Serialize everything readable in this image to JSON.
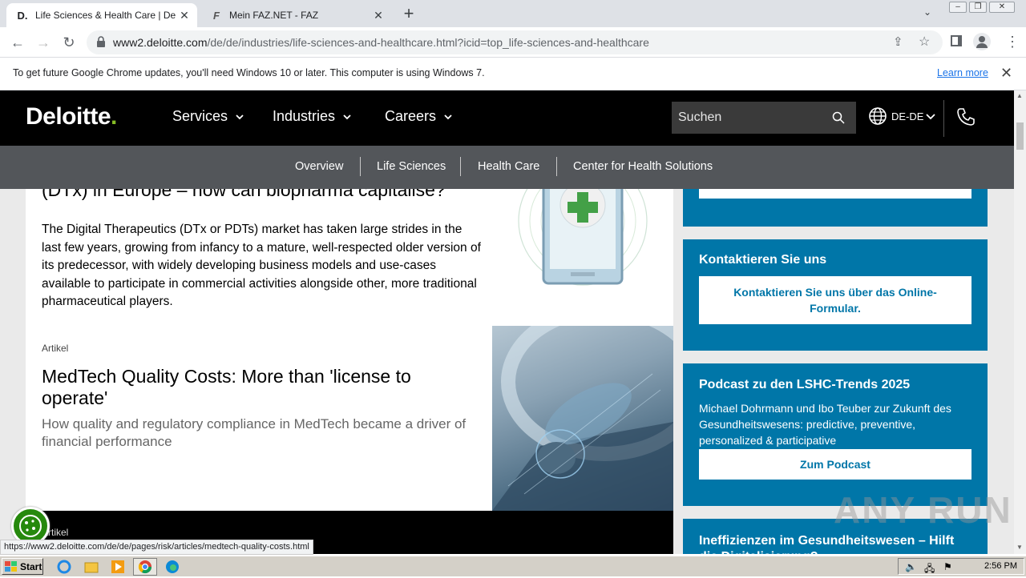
{
  "browser": {
    "tabs": [
      {
        "title": "Life Sciences & Health Care | Deloitte",
        "favicon": "D.",
        "active": true
      },
      {
        "title": "Mein FAZ.NET - FAZ",
        "favicon": "F",
        "active": false
      }
    ],
    "url_host": "www2.deloitte.com",
    "url_path": "/de/de/industries/life-sciences-and-healthcare.html?icid=top_life-sciences-and-healthcare",
    "infobar": {
      "message": "To get future Google Chrome updates, you'll need Windows 10 or later. This computer is using Windows 7.",
      "link": "Learn more"
    },
    "status_url": "https://www2.deloitte.com/de/de/pages/risk/articles/medtech-quality-costs.html"
  },
  "header": {
    "logo": "Deloitte",
    "logo_dot": ".",
    "nav": [
      "Services",
      "Industries",
      "Careers"
    ],
    "search_placeholder": "Suchen",
    "language": "DE-DE",
    "colors": {
      "brand_green": "#86bc25",
      "header_bg": "#000000",
      "subnav_bg": "#53565a"
    }
  },
  "subnav": [
    "Overview",
    "Life Sciences",
    "Health Care",
    "Center for Health Solutions"
  ],
  "articles": [
    {
      "title": "(DTx) in Europe – how can biopharma capitalise?",
      "description": "The Digital Therapeutics (DTx or PDTs) market has taken large strides in the last few years, growing from infancy to a mature, well-respected older version of its predecessor, with widely developing business models and use-cases available to participate in commercial activities alongside other, more traditional pharmaceutical players."
    },
    {
      "label": "Artikel",
      "title": "MedTech Quality Costs: More than 'license to operate'",
      "description": "How quality and regulatory compliance in MedTech became a driver of financial performance"
    },
    {
      "label": "Artikel"
    }
  ],
  "sidebar": {
    "contact": {
      "heading": "Kontaktieren Sie uns",
      "button": "Kontaktieren Sie uns über das Online-Formular."
    },
    "podcast": {
      "heading": "Podcast zu den LSHC-Trends 2025",
      "text": "Michael Dohrmann und Ibo Teuber zur Zukunft des Gesundheitswesens: predictive, preventive, personalized & participative",
      "button": "Zum Podcast"
    },
    "next_heading": "Ineffizienzen im Gesundheitswesen – Hilft die Digitalisierung?",
    "accent": "#0076a8"
  },
  "watermark": "ANY RUN",
  "taskbar": {
    "start": "Start",
    "clock": "2:56 PM"
  }
}
